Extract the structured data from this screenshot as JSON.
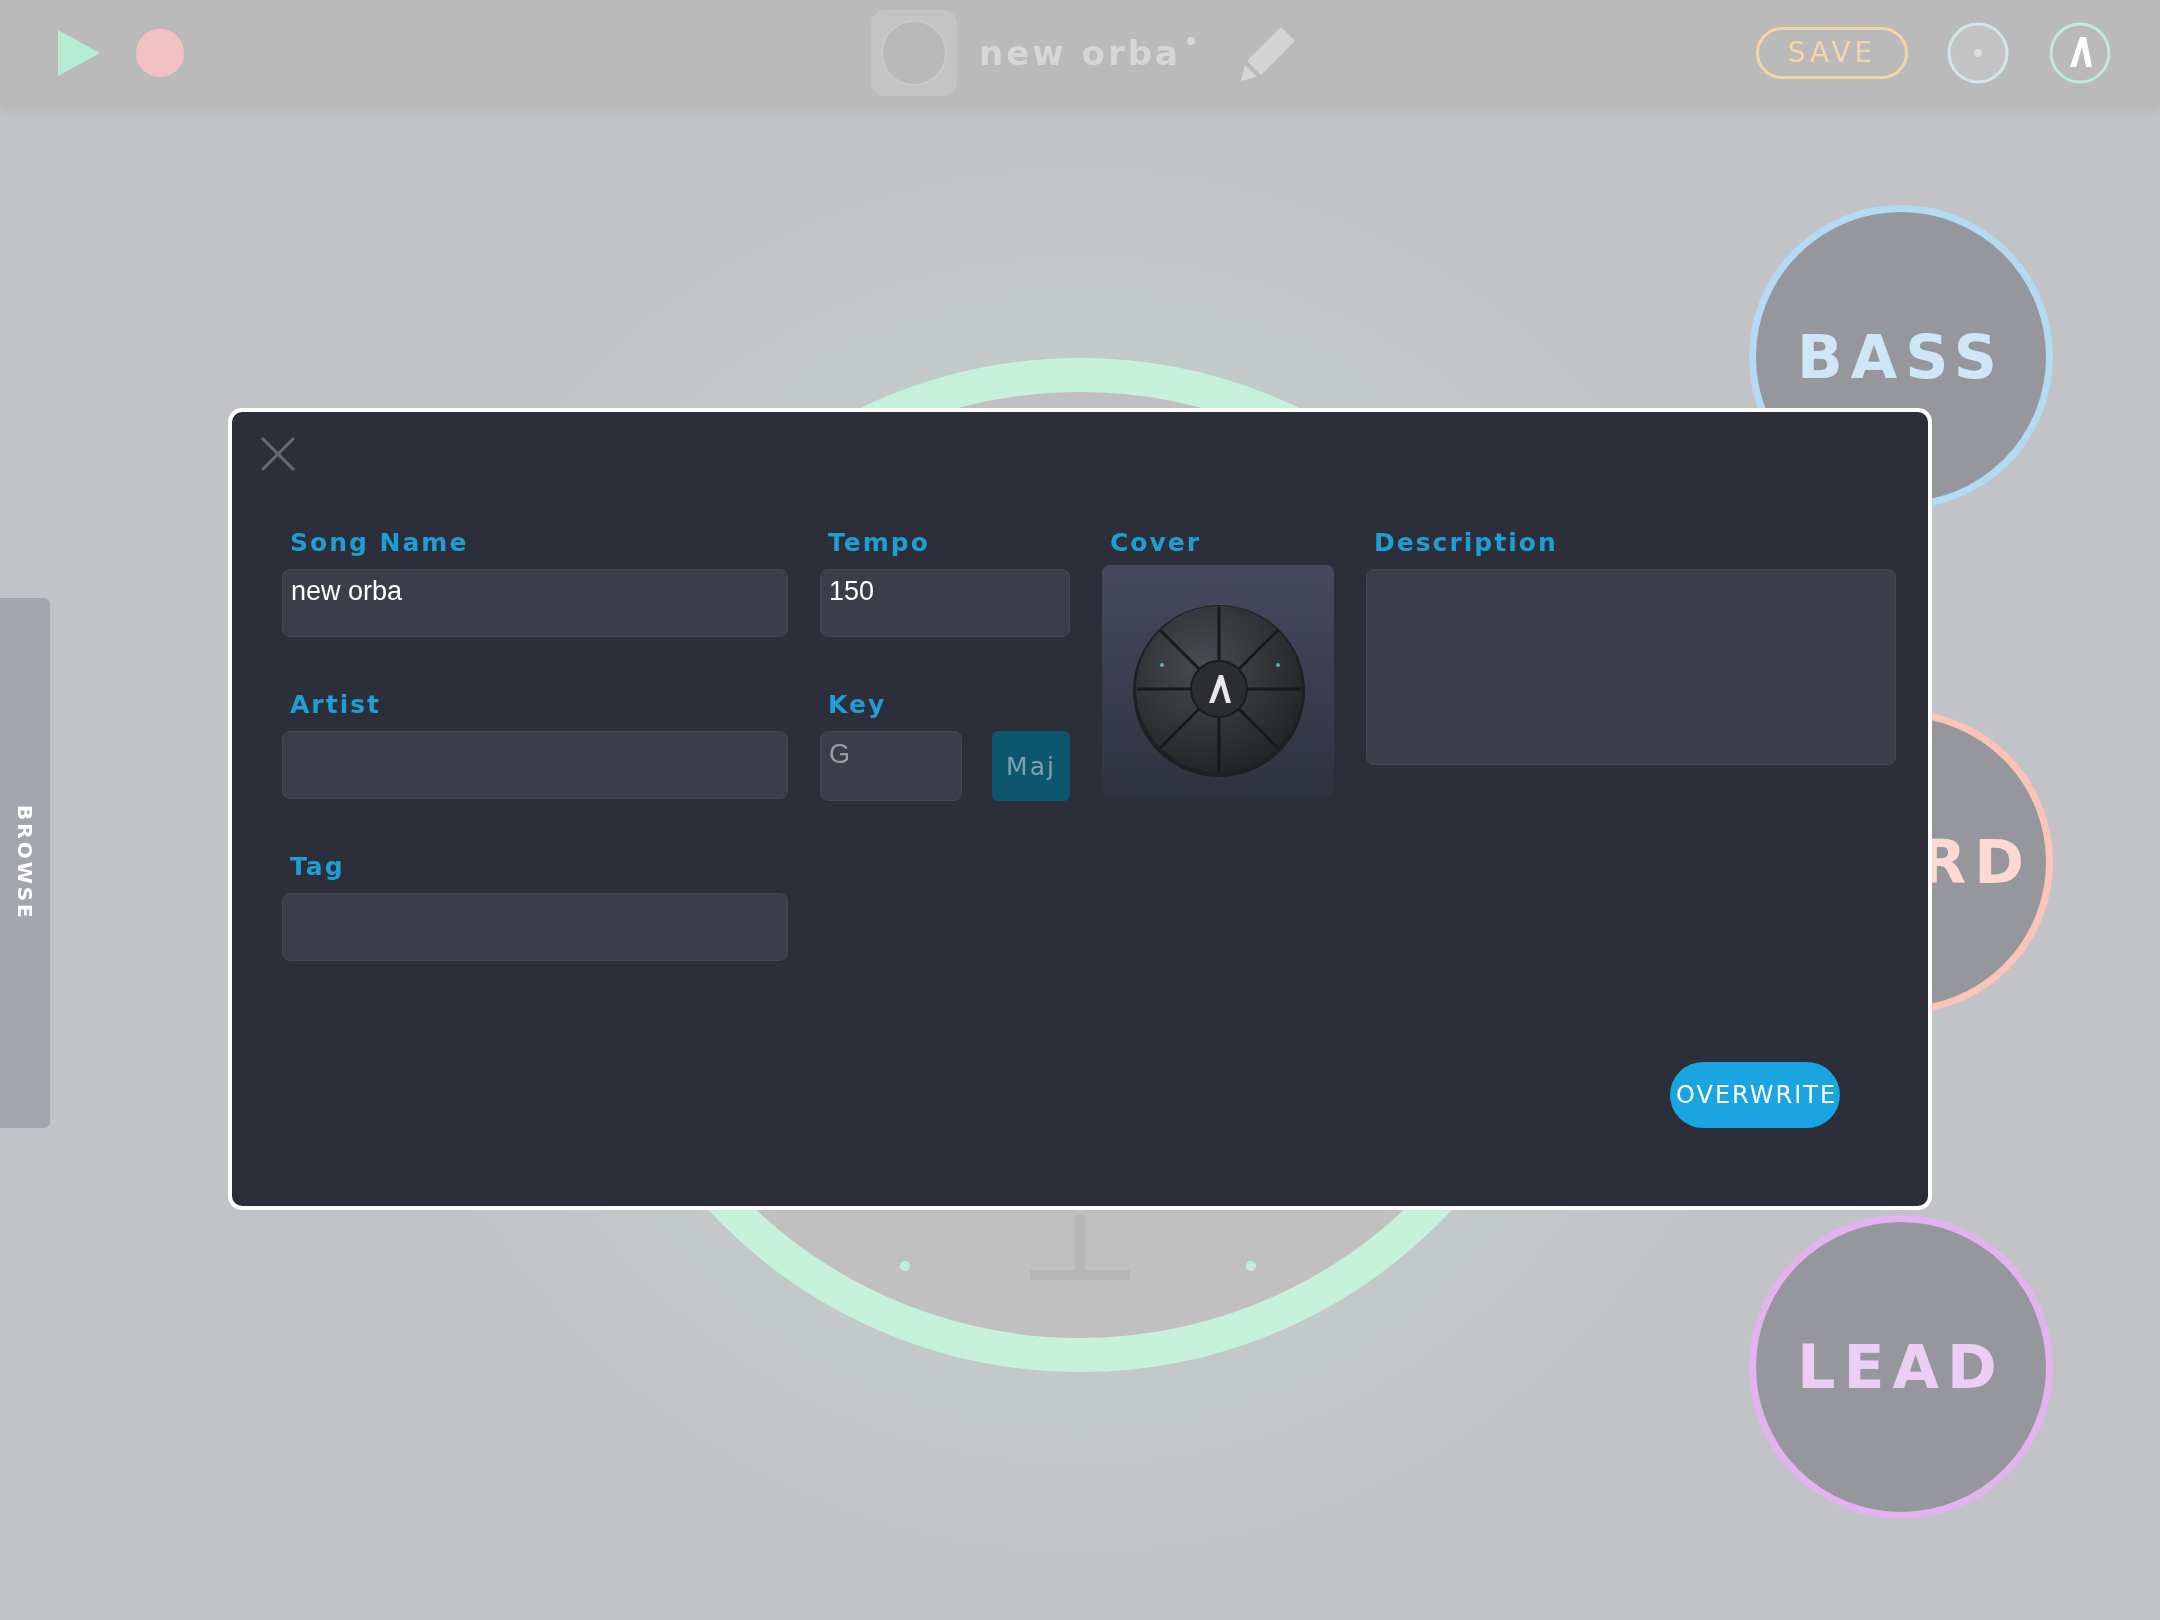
{
  "toolbar": {
    "title": "new orba",
    "unsaved": true,
    "save_label": "SAVE"
  },
  "browse_tab": {
    "label": "BROWSE"
  },
  "pads": [
    {
      "label": "BASS",
      "color": "#b3daf3"
    },
    {
      "label": "RD",
      "color": "#fcc4b8"
    },
    {
      "label": "LEAD",
      "color": "#e2b3ef"
    }
  ],
  "dialog": {
    "song_name": {
      "label": "Song Name",
      "value": "new orba"
    },
    "tempo": {
      "label": "Tempo",
      "value": "150"
    },
    "cover": {
      "label": "Cover",
      "kind": "picture"
    },
    "description": {
      "label": "Description"
    },
    "artist": {
      "label": "Artist"
    },
    "key": {
      "label": "Key",
      "placeholder": "G",
      "mode": "Maj"
    },
    "tag": {
      "label": "Tag"
    },
    "button": "OVERWRITE"
  }
}
